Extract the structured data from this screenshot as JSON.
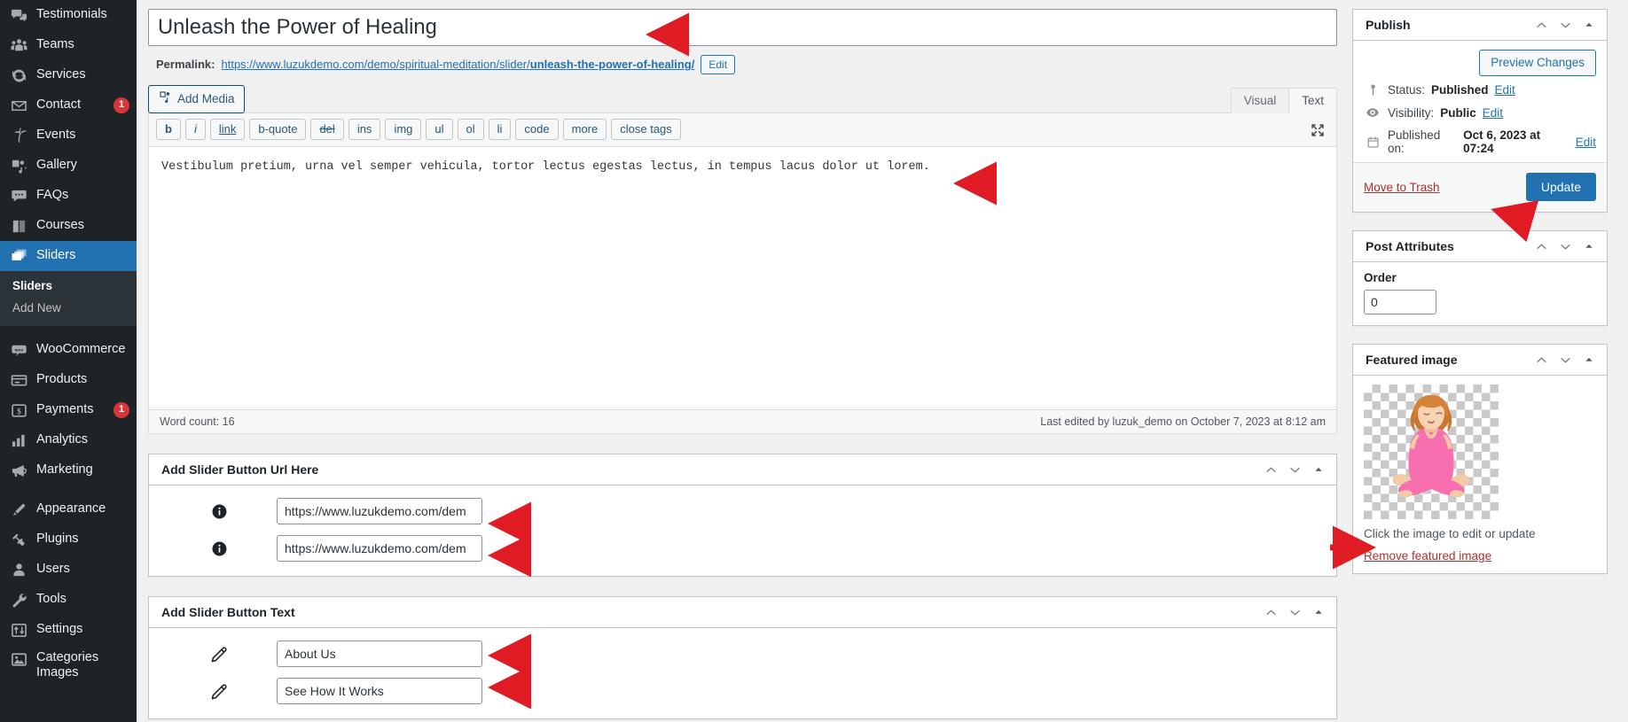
{
  "sidebar": {
    "items": [
      {
        "label": "Testimonials",
        "icon": "testimonials-icon",
        "badge": null
      },
      {
        "label": "Teams",
        "icon": "teams-icon",
        "badge": null
      },
      {
        "label": "Services",
        "icon": "services-icon",
        "badge": null
      },
      {
        "label": "Contact",
        "icon": "contact-icon",
        "badge": "1"
      },
      {
        "label": "Events",
        "icon": "events-icon",
        "badge": null
      },
      {
        "label": "Gallery",
        "icon": "gallery-icon",
        "badge": null
      },
      {
        "label": "FAQs",
        "icon": "faqs-icon",
        "badge": null
      },
      {
        "label": "Courses",
        "icon": "courses-icon",
        "badge": null
      },
      {
        "label": "Sliders",
        "icon": "sliders-icon",
        "badge": null,
        "current": true
      }
    ],
    "submenu": [
      {
        "label": "Sliders",
        "current": true
      },
      {
        "label": "Add New",
        "current": false
      }
    ],
    "items2": [
      {
        "label": "WooCommerce",
        "icon": "woocommerce-icon",
        "badge": null
      },
      {
        "label": "Products",
        "icon": "products-icon",
        "badge": null
      },
      {
        "label": "Payments",
        "icon": "payments-icon",
        "badge": "1"
      },
      {
        "label": "Analytics",
        "icon": "analytics-icon",
        "badge": null
      },
      {
        "label": "Marketing",
        "icon": "marketing-icon",
        "badge": null
      }
    ],
    "items3": [
      {
        "label": "Appearance",
        "icon": "appearance-icon",
        "badge": null
      },
      {
        "label": "Plugins",
        "icon": "plugins-icon",
        "badge": null
      },
      {
        "label": "Users",
        "icon": "users-icon",
        "badge": null
      },
      {
        "label": "Tools",
        "icon": "tools-icon",
        "badge": null
      },
      {
        "label": "Settings",
        "icon": "settings-icon",
        "badge": null
      },
      {
        "label": "Categories Images",
        "icon": "categories-images-icon",
        "badge": null,
        "two_line": true
      }
    ],
    "accent_current": "#2271b1",
    "bg": "#1d2327"
  },
  "post": {
    "title": "Unleash the Power of Healing",
    "title_placeholder": "Add title",
    "permalink_label": "Permalink:",
    "permalink_base": "https://www.luzukdemo.com/demo/spiritual-meditation/slider/",
    "permalink_slug": "unleash-the-power-of-healing/",
    "permalink_edit_label": "Edit"
  },
  "editor": {
    "add_media_label": "Add Media",
    "tabs": [
      {
        "label": "Visual",
        "active": false
      },
      {
        "label": "Text",
        "active": true
      }
    ],
    "quicktags": [
      {
        "label": "b",
        "style": "b"
      },
      {
        "label": "i",
        "style": "i"
      },
      {
        "label": "link",
        "style": "link"
      },
      {
        "label": "b-quote",
        "style": ""
      },
      {
        "label": "del",
        "style": "del"
      },
      {
        "label": "ins",
        "style": ""
      },
      {
        "label": "img",
        "style": ""
      },
      {
        "label": "ul",
        "style": ""
      },
      {
        "label": "ol",
        "style": ""
      },
      {
        "label": "li",
        "style": ""
      },
      {
        "label": "code",
        "style": ""
      },
      {
        "label": "more",
        "style": ""
      },
      {
        "label": "close tags",
        "style": ""
      }
    ],
    "content": "Vestibulum pretium, urna vel semper vehicula, tortor lectus egestas lectus, in tempus lacus dolor ut lorem.",
    "fullscreen_icon": "fullscreen-icon",
    "word_count": "Word count: 16",
    "last_edited": "Last edited by luzuk_demo on October 7, 2023 at 8:12 am"
  },
  "button_url_box": {
    "title": "Add Slider Button Url Here",
    "fields": [
      {
        "icon": "info-icon",
        "value": "https://www.luzukdemo.com/dem"
      },
      {
        "icon": "info-icon",
        "value": "https://www.luzukdemo.com/dem"
      }
    ]
  },
  "button_text_box": {
    "title": "Add Slider Button Text",
    "fields": [
      {
        "icon": "pencil-icon",
        "value": "About Us"
      },
      {
        "icon": "pencil-icon",
        "value": "See How It Works"
      }
    ]
  },
  "publish": {
    "title": "Publish",
    "preview_label": "Preview Changes",
    "status_label": "Status:",
    "status_value": "Published",
    "status_edit": "Edit",
    "visibility_label": "Visibility:",
    "visibility_value": "Public",
    "visibility_edit": "Edit",
    "published_label": "Published on:",
    "published_value": "Oct 6, 2023 at 07:24",
    "published_edit": "Edit",
    "trash_label": "Move to Trash",
    "update_label": "Update",
    "update_color": "#2271b1",
    "trash_color": "#b32d2e"
  },
  "post_attributes": {
    "title": "Post Attributes",
    "order_label": "Order",
    "order_value": "0"
  },
  "featured_image": {
    "title": "Featured image",
    "caption": "Click the image to edit or update",
    "remove_label": "Remove featured image",
    "alt": "woman-meditating-lotus-pose-pink-outfit"
  },
  "handle_icons": {
    "up": "chevron-up-icon",
    "down": "chevron-down-icon",
    "toggle": "caret-up-icon"
  }
}
